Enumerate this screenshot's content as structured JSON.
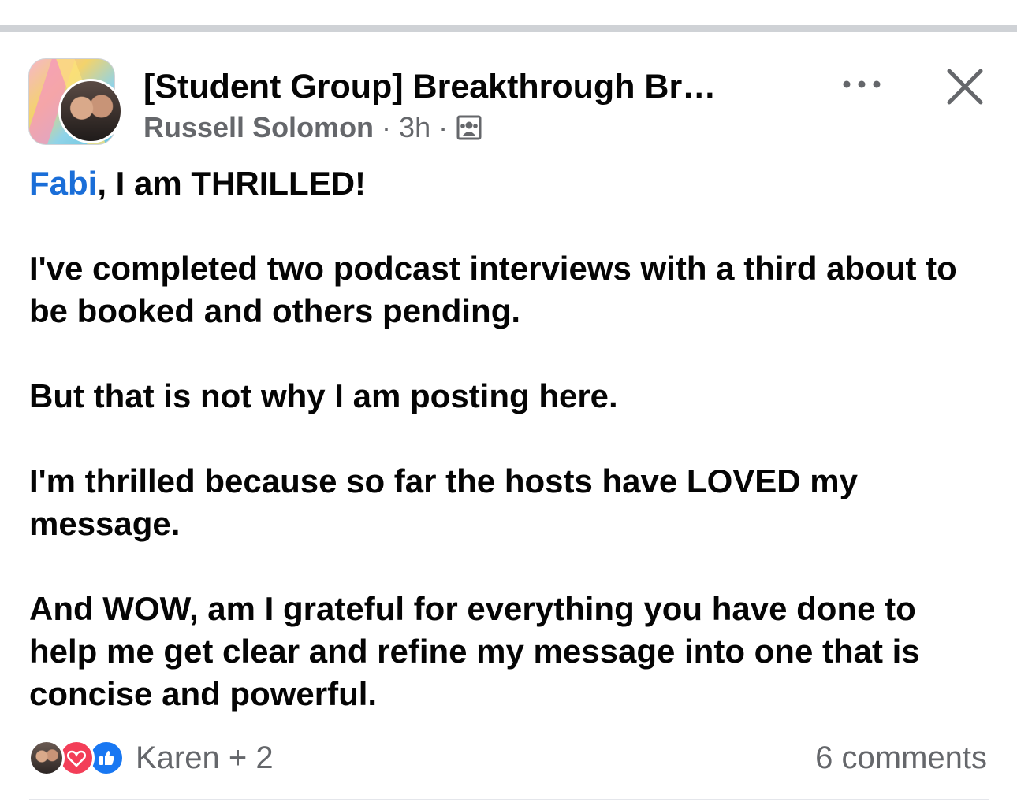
{
  "header": {
    "group_name": "[Student Group] Breakthrough Br…",
    "author": "Russell Solomon",
    "separator": "·",
    "time": "3h",
    "privacy_icon": "group-members-icon",
    "more_icon": "more-horizontal-icon",
    "close_icon": "close-icon"
  },
  "post": {
    "mention": "Fabi",
    "first_line_rest": ", I am THRILLED!",
    "paragraphs": [
      "I've completed two podcast interviews with a third about to be booked and others pending.",
      "But that is not why I am posting here.",
      "I'm thrilled because so far the hosts have LOVED my message.",
      "And WOW, am I grateful for everything you have done to help me get clear and refine my message into one that is concise and powerful."
    ]
  },
  "footer": {
    "reaction_icons": [
      "reactor-photo",
      "love-icon",
      "like-icon"
    ],
    "reactors": "Karen + 2",
    "comments": "6 comments"
  },
  "colors": {
    "mention": "#1a6ed8",
    "secondary_text": "#65676b",
    "love": "#f33e58",
    "like": "#1877f2"
  }
}
